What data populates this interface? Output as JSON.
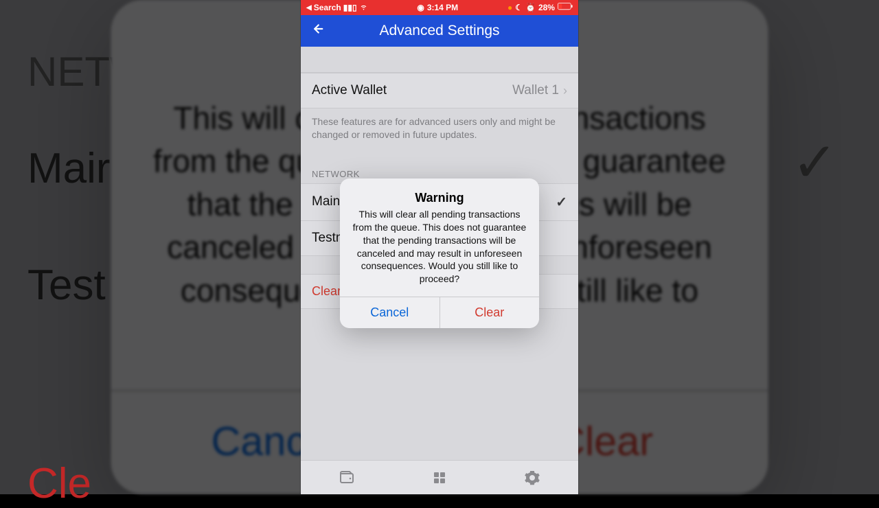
{
  "statusbar": {
    "back_app": "Search",
    "time": "3:14 PM",
    "battery": "28%"
  },
  "navbar": {
    "title": "Advanced Settings"
  },
  "wallet": {
    "label": "Active Wallet",
    "value": "Wallet 1"
  },
  "notice": "These features are for advanced users only and might be changed or removed in future updates.",
  "section": {
    "network_header": "NETWORK",
    "mainnet": "Mainnet",
    "testnet": "Testnet"
  },
  "danger": {
    "clear_pending": "Clear Pending Transactions"
  },
  "dialog": {
    "title": "Warning",
    "message": "This will clear all pending transactions from the queue. This does not guarantee that the pending transactions will be canceled and may result in unforeseen consequences. Would you still like to proceed?",
    "cancel": "Cancel",
    "clear": "Clear"
  },
  "bg": {
    "netw": "NETW",
    "mair": "Mair",
    "test": "Test",
    "cle": "Cle",
    "canc": "Canc",
    "lear": "lear"
  }
}
